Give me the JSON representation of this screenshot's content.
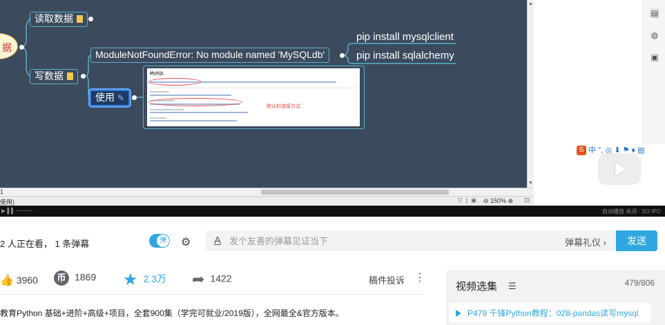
{
  "mindmap": {
    "root_label": "据",
    "node_read": "读取数据",
    "node_write": "写数据",
    "node_error": "ModuleNotFoundError: No module named 'MySQLdb'",
    "node_use": "使用",
    "leaf_1": "pip install mysqlclient",
    "leaf_2": "pip install sqlalchemy",
    "doc_title": "MySQL",
    "doc_annotation": "默认的连接方式"
  },
  "editor": {
    "sheet_label": "1",
    "bottom_left_text": "使用)",
    "zoom": "150%"
  },
  "ime": {
    "label": "中"
  },
  "player": {
    "controls_right": "自动播放 关闭 · SO IPO"
  },
  "danmaku": {
    "watching": "2 人正在看， 1 条弹幕",
    "toggle_label": "弹",
    "placeholder": "发个友善的弹幕见证当下",
    "etiquette": "弹幕礼仪 ›",
    "send_label": "发送"
  },
  "stats": {
    "likes": "3960",
    "coins": "1869",
    "favorites": "2.3万",
    "shares": "1422",
    "coin_icon_glyph": "币",
    "report_label": "稿件投诉",
    "more_label": "⋮",
    "accent_color": "#2fa7e0"
  },
  "description": "教育Python 基础+进阶+高级+项目，全套900集（学完可就业/2019版），全网最全&官方版本。",
  "playlist": {
    "title": "视频选集",
    "progress": "479/806",
    "current_item": "P479   千锋Python教程：028-pandas读写mysql"
  }
}
